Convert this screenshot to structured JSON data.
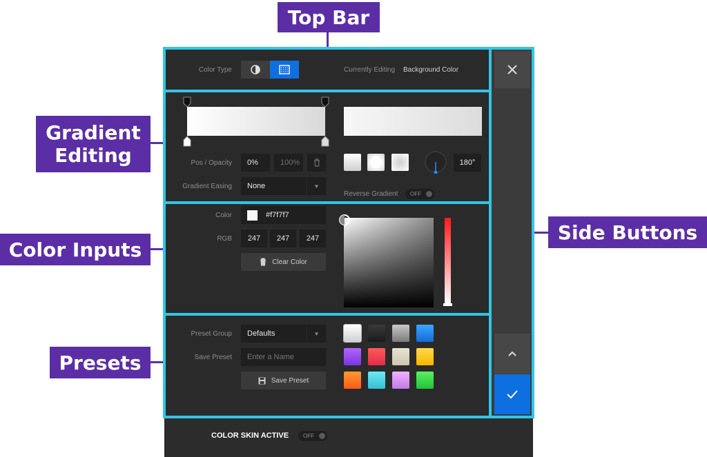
{
  "callouts": {
    "top_bar": "Top Bar",
    "gradient_editing": "Gradient\nEditing",
    "color_inputs": "Color Inputs",
    "presets": "Presets",
    "side_buttons": "Side Buttons"
  },
  "top_bar": {
    "color_type_label": "Color Type",
    "currently_editing_label": "Currently Editing",
    "currently_editing_value": "Background Color",
    "icons": [
      "drop-half-icon",
      "gradient-icon"
    ]
  },
  "gradient": {
    "pos_opacity_label": "Pos / Opacity",
    "pos_value": "0%",
    "opacity_value": "100%",
    "easing_label": "Gradient Easing",
    "easing_value": "None",
    "angle_value": "180°",
    "reverse_label": "Reverse Gradient",
    "reverse_toggle": "OFF"
  },
  "color_inputs": {
    "color_label": "Color",
    "hex_value": "#f7f7f7",
    "rgb_label": "RGB",
    "r": "247",
    "g": "247",
    "b": "247",
    "clear_label": "Clear Color",
    "swatch_color": "#f7f7f7"
  },
  "presets": {
    "group_label": "Preset Group",
    "group_value": "Defaults",
    "save_label": "Save Preset",
    "name_placeholder": "Enter a Name",
    "save_button": "Save Preset",
    "swatches": [
      "linear-gradient(#ffffff,#d0d0d0)",
      "linear-gradient(#3a3a3a,#1a1a1a)",
      "linear-gradient(#c8c8c8,#7a7a7a)",
      "linear-gradient(#37a8ff,#1769d6)",
      "linear-gradient(#b266ff,#7a35e0)",
      "linear-gradient(#ff5a5a,#e22c4a)",
      "linear-gradient(#e8e2d2,#cfc6b0)",
      "linear-gradient(#ffd84a,#f5b700)",
      "linear-gradient(#ff9a2e,#ff5a1a)",
      "linear-gradient(#6ee8f0,#34c0d8)",
      "linear-gradient(#f0b0ff,#c07ae8)",
      "linear-gradient(#5cf060,#22c43a)"
    ]
  },
  "footer": {
    "skin_label": "COLOR SKIN ACTIVE",
    "skin_toggle": "OFF"
  },
  "colors": {
    "accent_blue": "#0d6fe0",
    "section_border": "#35c4e3",
    "callout": "#5b2ea6"
  }
}
